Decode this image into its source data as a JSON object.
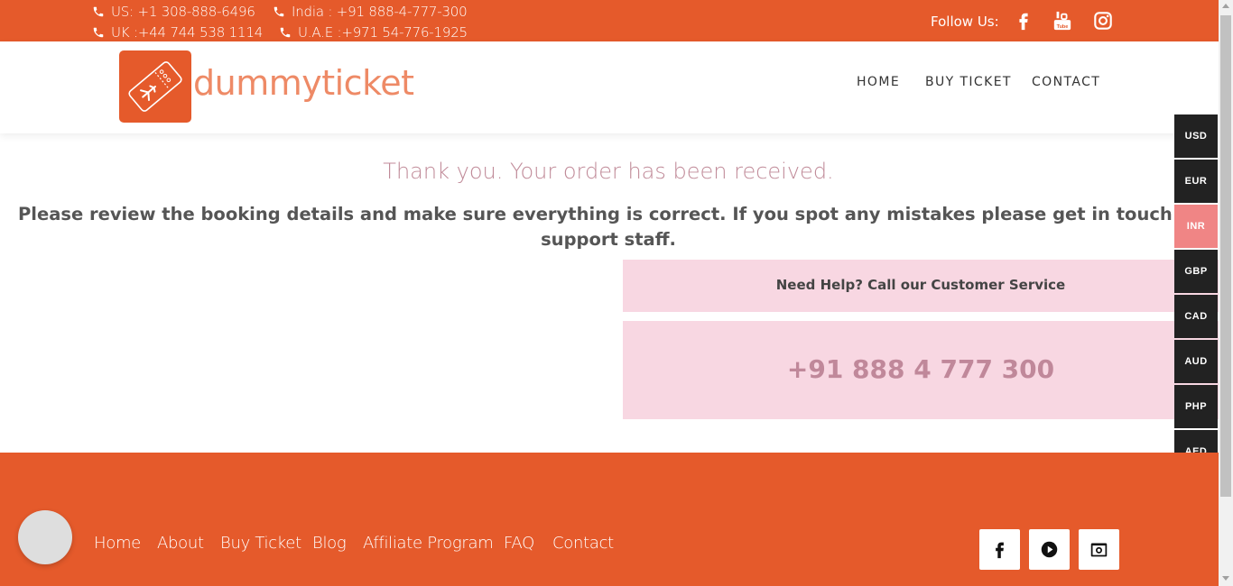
{
  "topbar": {
    "phones": {
      "us": "US: +1 308-888-6496",
      "india": "India : +91 888-4-777-300",
      "uk": "UK :+44 744 538 1114",
      "uae": "U.A.E :+971 54-776-1925"
    },
    "follow_label": "Follow Us:",
    "social_icons": [
      "facebook-icon",
      "youtube-icon",
      "instagram-icon"
    ]
  },
  "header": {
    "logo_text": "dummyticket",
    "nav": [
      "HOME",
      "BUY TICKET",
      "CONTACT"
    ]
  },
  "main": {
    "thanks": "Thank you. Your order has been received.",
    "review_line1": "Please review the booking details and make sure everything is correct. If you spot any mistakes please get in touch with any of our",
    "review_line2": "support staff.",
    "help_label": "Need Help? Call our Customer Service",
    "help_phone": "+91 888 4 777 300"
  },
  "currencies": {
    "items": [
      "USD",
      "EUR",
      "INR",
      "GBP",
      "CAD",
      "AUD",
      "PHP",
      "AED"
    ],
    "active": "INR"
  },
  "footer": {
    "links": [
      "Home",
      "About",
      "Buy Ticket",
      "Blog",
      "Affiliate Program",
      "FAQ",
      "Contact"
    ],
    "social_icons": [
      "facebook-icon",
      "play-icon",
      "camera-icon"
    ]
  },
  "colors": {
    "brand": "#e55a2b",
    "pink_panel": "#f8d7e2",
    "active_currency": "#f08585",
    "sidebar_dark": "#222222"
  }
}
